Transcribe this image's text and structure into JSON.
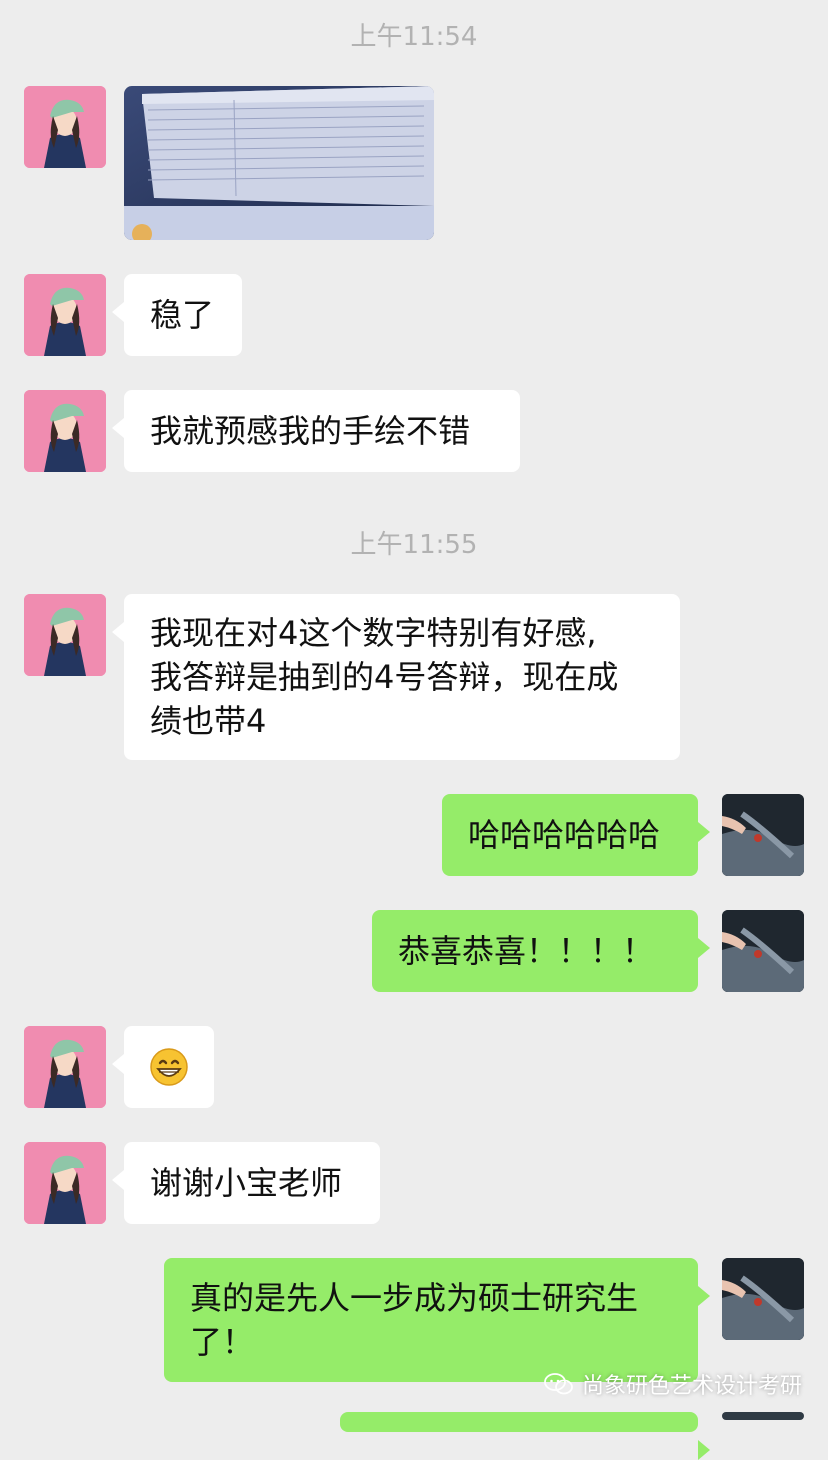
{
  "timestamps": [
    "上午11:54",
    "上午11:55"
  ],
  "messages": {
    "m1": "稳了",
    "m2": "我就预感我的手绘不错",
    "m3_line1": "我现在对4这个数字特别有好感,",
    "m3_line2": "我答辩是抽到的4号答辩，现在成",
    "m3_line3": "绩也带4",
    "m4": "哈哈哈哈哈哈",
    "m5": "恭喜恭喜！！！！",
    "m7": "谢谢小宝老师",
    "m8_line1": "真的是先人一步成为硕士研究生",
    "m8_line2": "了！"
  },
  "watermark": "尚象研色艺术设计考研",
  "icons": {
    "avatar_left": "cartoon-girl-avatar",
    "avatar_right": "hand-on-rock-avatar",
    "emoji": "grinning-emoji-icon",
    "watermark": "wechat-icon"
  },
  "colors": {
    "background": "#ededed",
    "incoming_bubble": "#ffffff",
    "outgoing_bubble": "#95ec69",
    "timestamp": "#b2b2b2"
  }
}
